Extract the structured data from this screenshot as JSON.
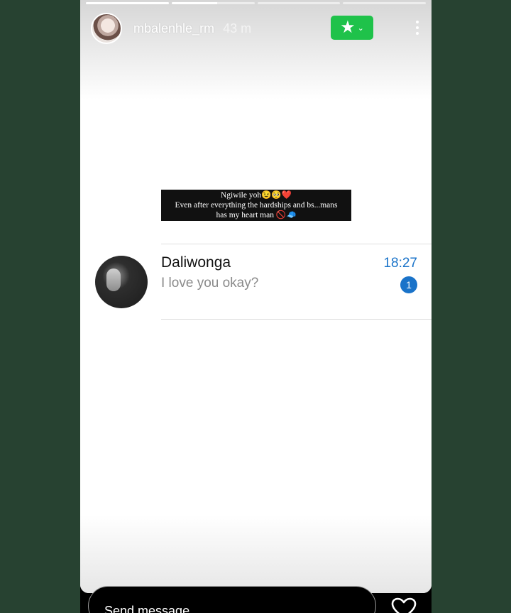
{
  "story": {
    "progress": [
      1.0,
      0.55,
      0.0,
      0.0
    ],
    "user": {
      "username": "mbalenhle_rm",
      "time_ago": "43 m"
    },
    "close_friends": {
      "icon": "star-icon",
      "color": "#1fc24a"
    },
    "menu_icon": "more-vertical-icon"
  },
  "caption": {
    "line1": "Ngiwile yoh😉🥺❤️",
    "line2": "Even after everything the hardships and bs...mans",
    "line3": "has my heart man 🚫🧢"
  },
  "chat": {
    "contact_name": "Daliwonga",
    "message": "I love you okay?",
    "time": "18:27",
    "unread_count": "1",
    "accent": "#1a73c9"
  },
  "reply": {
    "placeholder": "Send message",
    "like_icon": "heart-icon"
  }
}
